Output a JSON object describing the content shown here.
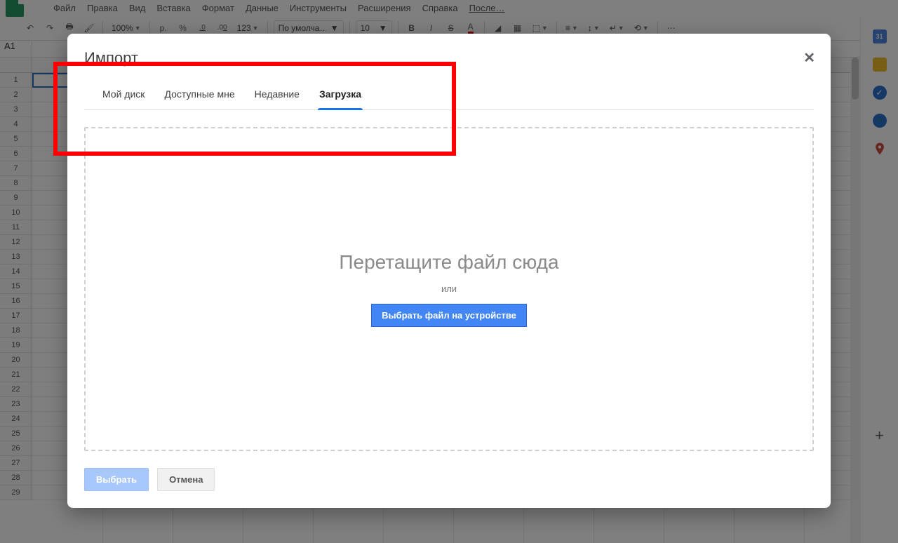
{
  "menu": {
    "items": [
      "Файл",
      "Правка",
      "Вид",
      "Вставка",
      "Формат",
      "Данные",
      "Инструменты",
      "Расширения",
      "Справка"
    ],
    "last_edit": "После…"
  },
  "toolbar": {
    "zoom": "100%",
    "currency": "р.",
    "percent": "%",
    "dec_less": ".0",
    "dec_more": ".00",
    "num_format": "123",
    "font": "По умолча…",
    "font_size": "10",
    "more": "⋯"
  },
  "name_box": "A1",
  "rows": [
    1,
    2,
    3,
    4,
    5,
    6,
    7,
    8,
    9,
    10,
    11,
    12,
    13,
    14,
    15,
    16,
    17,
    18,
    19,
    20,
    21,
    22,
    23,
    24,
    25,
    26,
    27,
    28,
    29
  ],
  "side": {
    "calendar_day": "31"
  },
  "modal": {
    "title": "Импорт",
    "tabs": [
      {
        "label": "Мой диск",
        "active": false
      },
      {
        "label": "Доступные мне",
        "active": false
      },
      {
        "label": "Недавние",
        "active": false
      },
      {
        "label": "Загрузка",
        "active": true
      }
    ],
    "drop_text": "Перетащите файл сюда",
    "or_text": "или",
    "choose_btn": "Выбрать файл на устройстве",
    "select_btn": "Выбрать",
    "cancel_btn": "Отмена"
  }
}
